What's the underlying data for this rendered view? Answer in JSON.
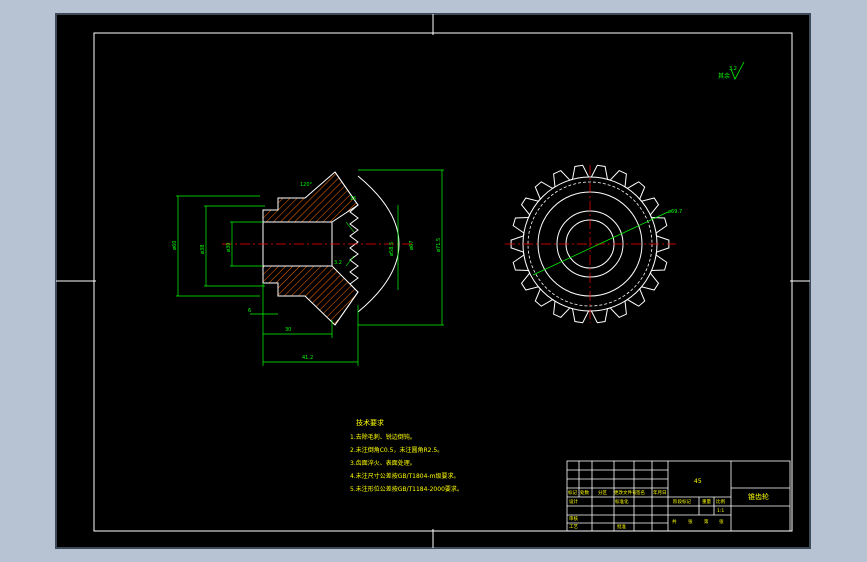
{
  "colors": {
    "background": "#b7c3d3",
    "sheet": "#000000",
    "frame": "#ffffff",
    "dimension": "#00ff00",
    "hatch": "#ff6a00",
    "centerline": "#ff0000",
    "notes_text": "#ffff00"
  },
  "surface_finish": {
    "symbol": "3.2"
  },
  "section_view": {
    "dimensions": {
      "bore_dia": "ø30",
      "hub_dia": "ø38",
      "left_height": "ø60",
      "cone_dia_1": "ø58.5",
      "cone_dia_2": "ø67",
      "overall_dia": "ø71.5",
      "angle": "120°",
      "face_width": "15",
      "tooth_len": "3.2",
      "chamfer": "6",
      "hub_len": "30",
      "overall_len": "41.2"
    }
  },
  "front_view": {
    "tip_label": "ø69.7"
  },
  "technical_notes": {
    "title": "技术要求",
    "items": [
      "1.去除毛刺、锐边倒钝。",
      "2.未注倒角C0.5，未注圆角R2.5。",
      "3.齿面淬火、表面处理。",
      "4.未注尺寸公差按GB/T1804-m级要求。",
      "5.未注形位公差按GB/T1184-2000要求。"
    ]
  },
  "title_block": {
    "material": "45",
    "part_name": "锥齿轮",
    "row_labels": [
      "标记",
      "处数",
      "分区",
      "更改文件号",
      "签名",
      "年月日"
    ],
    "designer": "设计",
    "standard": "标准化",
    "stage": "阶段标记",
    "weight": "重量",
    "scale": "比例",
    "ratio": "1:1",
    "review": "审核",
    "process": "工艺",
    "approve": "批准",
    "sheet": "共",
    "sheet_of": "第",
    "sheet_unit": "张"
  }
}
